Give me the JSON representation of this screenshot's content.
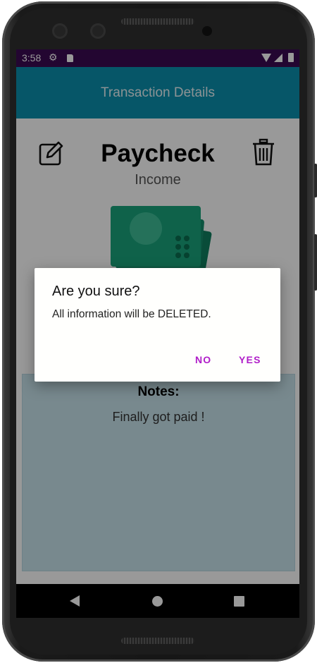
{
  "status_bar": {
    "time": "3:58"
  },
  "app_bar": {
    "title": "Transaction Details"
  },
  "transaction": {
    "name": "Paycheck",
    "category": "Income"
  },
  "notes": {
    "label": "Notes:",
    "text": "Finally got paid !"
  },
  "dialog": {
    "title": "Are you sure?",
    "message": "All information will be DELETED.",
    "no_label": "NO",
    "yes_label": "YES"
  },
  "colors": {
    "status_bar": "#3b0a52",
    "app_bar": "#0a90ad",
    "notes_panel": "#c8e5ed",
    "dialog_button": "#b01ec9",
    "money_icon": "#1aa47c"
  },
  "icons": {
    "edit": "edit-icon",
    "delete": "trash-icon",
    "money": "cash-icon"
  }
}
